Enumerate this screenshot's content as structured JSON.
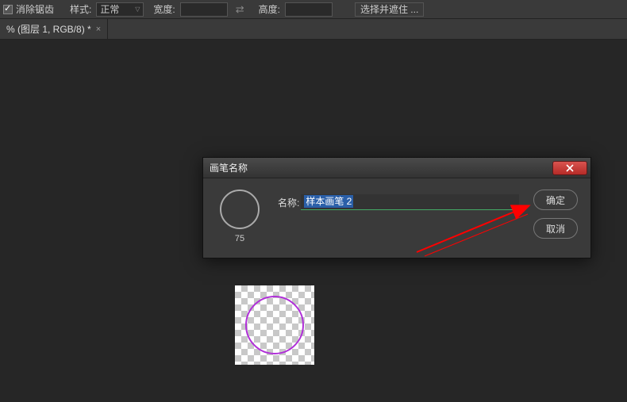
{
  "options": {
    "antiAliasLabel": "消除锯齿",
    "styleLabel": "样式:",
    "styleValue": "正常",
    "widthLabel": "宽度:",
    "heightLabel": "高度:",
    "selectMaskLabel": "选择并遮住 ..."
  },
  "docTab": {
    "title": "% (图层 1, RGB/8) *"
  },
  "dialog": {
    "title": "画笔名称",
    "nameLabel": "名称:",
    "nameValue": "样本画笔 2",
    "previewSize": "75",
    "okLabel": "确定",
    "cancelLabel": "取消"
  }
}
